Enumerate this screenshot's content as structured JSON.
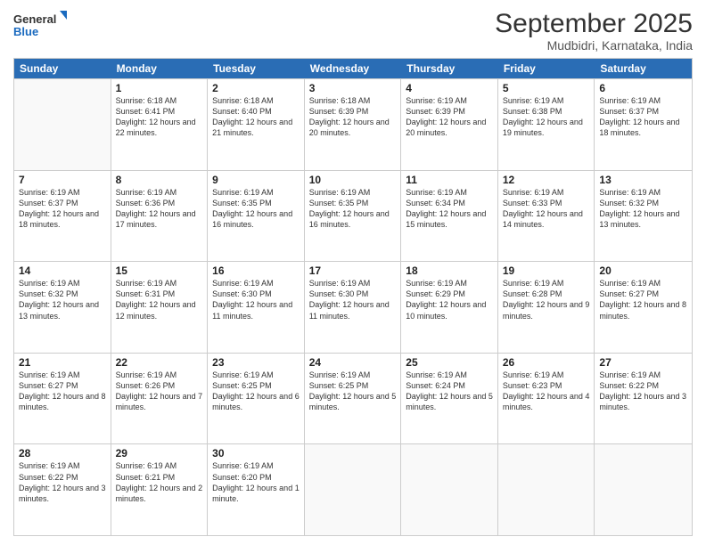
{
  "header": {
    "logo_line1": "General",
    "logo_line2": "Blue",
    "month_year": "September 2025",
    "location": "Mudbidri, Karnataka, India"
  },
  "days": [
    "Sunday",
    "Monday",
    "Tuesday",
    "Wednesday",
    "Thursday",
    "Friday",
    "Saturday"
  ],
  "weeks": [
    [
      {
        "day": "",
        "sunrise": "",
        "sunset": "",
        "daylight": ""
      },
      {
        "day": "1",
        "sunrise": "Sunrise: 6:18 AM",
        "sunset": "Sunset: 6:41 PM",
        "daylight": "Daylight: 12 hours and 22 minutes."
      },
      {
        "day": "2",
        "sunrise": "Sunrise: 6:18 AM",
        "sunset": "Sunset: 6:40 PM",
        "daylight": "Daylight: 12 hours and 21 minutes."
      },
      {
        "day": "3",
        "sunrise": "Sunrise: 6:18 AM",
        "sunset": "Sunset: 6:39 PM",
        "daylight": "Daylight: 12 hours and 20 minutes."
      },
      {
        "day": "4",
        "sunrise": "Sunrise: 6:19 AM",
        "sunset": "Sunset: 6:39 PM",
        "daylight": "Daylight: 12 hours and 20 minutes."
      },
      {
        "day": "5",
        "sunrise": "Sunrise: 6:19 AM",
        "sunset": "Sunset: 6:38 PM",
        "daylight": "Daylight: 12 hours and 19 minutes."
      },
      {
        "day": "6",
        "sunrise": "Sunrise: 6:19 AM",
        "sunset": "Sunset: 6:37 PM",
        "daylight": "Daylight: 12 hours and 18 minutes."
      }
    ],
    [
      {
        "day": "7",
        "sunrise": "Sunrise: 6:19 AM",
        "sunset": "Sunset: 6:37 PM",
        "daylight": "Daylight: 12 hours and 18 minutes."
      },
      {
        "day": "8",
        "sunrise": "Sunrise: 6:19 AM",
        "sunset": "Sunset: 6:36 PM",
        "daylight": "Daylight: 12 hours and 17 minutes."
      },
      {
        "day": "9",
        "sunrise": "Sunrise: 6:19 AM",
        "sunset": "Sunset: 6:35 PM",
        "daylight": "Daylight: 12 hours and 16 minutes."
      },
      {
        "day": "10",
        "sunrise": "Sunrise: 6:19 AM",
        "sunset": "Sunset: 6:35 PM",
        "daylight": "Daylight: 12 hours and 16 minutes."
      },
      {
        "day": "11",
        "sunrise": "Sunrise: 6:19 AM",
        "sunset": "Sunset: 6:34 PM",
        "daylight": "Daylight: 12 hours and 15 minutes."
      },
      {
        "day": "12",
        "sunrise": "Sunrise: 6:19 AM",
        "sunset": "Sunset: 6:33 PM",
        "daylight": "Daylight: 12 hours and 14 minutes."
      },
      {
        "day": "13",
        "sunrise": "Sunrise: 6:19 AM",
        "sunset": "Sunset: 6:32 PM",
        "daylight": "Daylight: 12 hours and 13 minutes."
      }
    ],
    [
      {
        "day": "14",
        "sunrise": "Sunrise: 6:19 AM",
        "sunset": "Sunset: 6:32 PM",
        "daylight": "Daylight: 12 hours and 13 minutes."
      },
      {
        "day": "15",
        "sunrise": "Sunrise: 6:19 AM",
        "sunset": "Sunset: 6:31 PM",
        "daylight": "Daylight: 12 hours and 12 minutes."
      },
      {
        "day": "16",
        "sunrise": "Sunrise: 6:19 AM",
        "sunset": "Sunset: 6:30 PM",
        "daylight": "Daylight: 12 hours and 11 minutes."
      },
      {
        "day": "17",
        "sunrise": "Sunrise: 6:19 AM",
        "sunset": "Sunset: 6:30 PM",
        "daylight": "Daylight: 12 hours and 11 minutes."
      },
      {
        "day": "18",
        "sunrise": "Sunrise: 6:19 AM",
        "sunset": "Sunset: 6:29 PM",
        "daylight": "Daylight: 12 hours and 10 minutes."
      },
      {
        "day": "19",
        "sunrise": "Sunrise: 6:19 AM",
        "sunset": "Sunset: 6:28 PM",
        "daylight": "Daylight: 12 hours and 9 minutes."
      },
      {
        "day": "20",
        "sunrise": "Sunrise: 6:19 AM",
        "sunset": "Sunset: 6:27 PM",
        "daylight": "Daylight: 12 hours and 8 minutes."
      }
    ],
    [
      {
        "day": "21",
        "sunrise": "Sunrise: 6:19 AM",
        "sunset": "Sunset: 6:27 PM",
        "daylight": "Daylight: 12 hours and 8 minutes."
      },
      {
        "day": "22",
        "sunrise": "Sunrise: 6:19 AM",
        "sunset": "Sunset: 6:26 PM",
        "daylight": "Daylight: 12 hours and 7 minutes."
      },
      {
        "day": "23",
        "sunrise": "Sunrise: 6:19 AM",
        "sunset": "Sunset: 6:25 PM",
        "daylight": "Daylight: 12 hours and 6 minutes."
      },
      {
        "day": "24",
        "sunrise": "Sunrise: 6:19 AM",
        "sunset": "Sunset: 6:25 PM",
        "daylight": "Daylight: 12 hours and 5 minutes."
      },
      {
        "day": "25",
        "sunrise": "Sunrise: 6:19 AM",
        "sunset": "Sunset: 6:24 PM",
        "daylight": "Daylight: 12 hours and 5 minutes."
      },
      {
        "day": "26",
        "sunrise": "Sunrise: 6:19 AM",
        "sunset": "Sunset: 6:23 PM",
        "daylight": "Daylight: 12 hours and 4 minutes."
      },
      {
        "day": "27",
        "sunrise": "Sunrise: 6:19 AM",
        "sunset": "Sunset: 6:22 PM",
        "daylight": "Daylight: 12 hours and 3 minutes."
      }
    ],
    [
      {
        "day": "28",
        "sunrise": "Sunrise: 6:19 AM",
        "sunset": "Sunset: 6:22 PM",
        "daylight": "Daylight: 12 hours and 3 minutes."
      },
      {
        "day": "29",
        "sunrise": "Sunrise: 6:19 AM",
        "sunset": "Sunset: 6:21 PM",
        "daylight": "Daylight: 12 hours and 2 minutes."
      },
      {
        "day": "30",
        "sunrise": "Sunrise: 6:19 AM",
        "sunset": "Sunset: 6:20 PM",
        "daylight": "Daylight: 12 hours and 1 minute."
      },
      {
        "day": "",
        "sunrise": "",
        "sunset": "",
        "daylight": ""
      },
      {
        "day": "",
        "sunrise": "",
        "sunset": "",
        "daylight": ""
      },
      {
        "day": "",
        "sunrise": "",
        "sunset": "",
        "daylight": ""
      },
      {
        "day": "",
        "sunrise": "",
        "sunset": "",
        "daylight": ""
      }
    ]
  ]
}
